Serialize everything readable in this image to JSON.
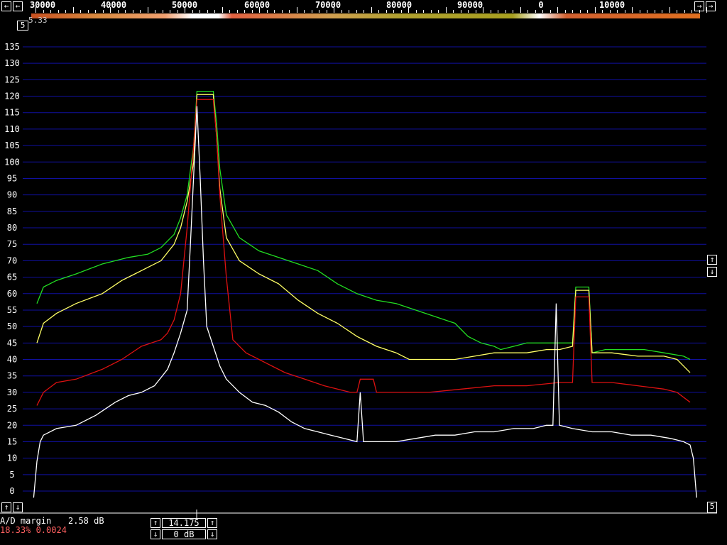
{
  "header": {
    "freq_labels": [
      "30000",
      "40000",
      "50000",
      "60000",
      "70000",
      "80000",
      "90000",
      "0",
      "10000"
    ],
    "left_scroll_icon": "left-arrow-icon",
    "right_scroll_icon": "right-arrow-icon"
  },
  "top_left": {
    "readout": "5.33",
    "box": "5"
  },
  "right_controls": {
    "up": "↑",
    "down": "↓"
  },
  "bottom_left_controls": {
    "up": "↑",
    "down": "↓"
  },
  "bottom_right_box": "5",
  "status": {
    "ad_margin_label": "A/D margin",
    "ad_margin_value": "2.58 dB",
    "cpu_line": "18.33% 0.0024"
  },
  "center_controls": {
    "top_value": "14.175",
    "bottom_value": "0 dB"
  },
  "colors": {
    "grid": "#1010a0",
    "green": "#22dd22",
    "yellow": "#ffff66",
    "red": "#dd1111",
    "white": "#ffffff"
  },
  "chart_data": {
    "type": "line",
    "title": "",
    "xlabel": "",
    "ylabel": "",
    "ylim": [
      -7,
      137
    ],
    "y_ticks": [
      0,
      5,
      10,
      15,
      20,
      25,
      30,
      35,
      40,
      45,
      50,
      55,
      60,
      65,
      70,
      75,
      80,
      85,
      90,
      95,
      100,
      105,
      110,
      115,
      120,
      125,
      130,
      135
    ],
    "x_tick_labels": [
      "30000",
      "40000",
      "50000",
      "60000",
      "70000",
      "80000",
      "90000",
      "0",
      "10000"
    ],
    "x_axis_note": "bin index 0..100 across the spectrum display",
    "series": [
      {
        "color": "#22dd22",
        "points": [
          [
            0,
            57
          ],
          [
            1,
            62
          ],
          [
            3,
            64
          ],
          [
            6,
            66
          ],
          [
            10,
            69
          ],
          [
            14,
            71
          ],
          [
            17,
            72
          ],
          [
            19,
            74
          ],
          [
            21,
            78
          ],
          [
            22,
            83
          ],
          [
            23,
            90
          ],
          [
            24,
            105
          ],
          [
            24.5,
            121.5
          ],
          [
            27,
            121.5
          ],
          [
            27.5,
            112
          ],
          [
            28,
            98
          ],
          [
            29,
            84
          ],
          [
            31,
            77
          ],
          [
            34,
            73
          ],
          [
            37,
            71
          ],
          [
            40,
            69
          ],
          [
            43,
            67
          ],
          [
            46,
            63
          ],
          [
            49,
            60
          ],
          [
            52,
            58
          ],
          [
            55,
            57
          ],
          [
            58,
            55
          ],
          [
            61,
            53
          ],
          [
            64,
            51
          ],
          [
            66,
            47
          ],
          [
            68,
            45
          ],
          [
            70,
            44
          ],
          [
            71,
            43
          ],
          [
            73,
            44
          ],
          [
            75,
            45
          ],
          [
            77,
            45
          ],
          [
            79,
            45
          ],
          [
            81,
            45
          ],
          [
            82,
            45
          ],
          [
            82.5,
            62
          ],
          [
            84.5,
            62
          ],
          [
            85,
            42
          ],
          [
            87,
            43
          ],
          [
            90,
            43
          ],
          [
            93,
            43
          ],
          [
            96,
            42
          ],
          [
            99,
            41
          ],
          [
            100,
            40
          ]
        ]
      },
      {
        "color": "#ffff66",
        "points": [
          [
            0,
            45
          ],
          [
            1,
            51
          ],
          [
            3,
            54
          ],
          [
            6,
            57
          ],
          [
            10,
            60
          ],
          [
            13,
            64
          ],
          [
            15,
            66
          ],
          [
            17,
            68
          ],
          [
            19,
            70
          ],
          [
            21,
            75
          ],
          [
            22,
            80
          ],
          [
            23,
            88
          ],
          [
            24,
            100
          ],
          [
            24.5,
            120.5
          ],
          [
            27,
            120.5
          ],
          [
            27.5,
            108
          ],
          [
            28,
            92
          ],
          [
            29,
            77
          ],
          [
            31,
            70
          ],
          [
            34,
            66
          ],
          [
            37,
            63
          ],
          [
            40,
            58
          ],
          [
            43,
            54
          ],
          [
            46,
            51
          ],
          [
            49,
            47
          ],
          [
            52,
            44
          ],
          [
            55,
            42
          ],
          [
            57,
            40
          ],
          [
            60,
            40
          ],
          [
            64,
            40
          ],
          [
            67,
            41
          ],
          [
            70,
            42
          ],
          [
            75,
            42
          ],
          [
            78,
            43
          ],
          [
            80,
            43
          ],
          [
            82,
            44
          ],
          [
            82.5,
            61
          ],
          [
            84.5,
            61
          ],
          [
            85,
            42
          ],
          [
            88,
            42
          ],
          [
            92,
            41
          ],
          [
            96,
            41
          ],
          [
            98,
            40
          ],
          [
            100,
            36
          ]
        ]
      },
      {
        "color": "#dd1111",
        "points": [
          [
            0,
            26
          ],
          [
            1,
            30
          ],
          [
            3,
            33
          ],
          [
            6,
            34
          ],
          [
            10,
            37
          ],
          [
            13,
            40
          ],
          [
            16,
            44
          ],
          [
            19,
            46
          ],
          [
            20,
            48
          ],
          [
            21,
            52
          ],
          [
            22,
            60
          ],
          [
            23,
            80
          ],
          [
            24,
            105
          ],
          [
            24.5,
            119
          ],
          [
            27,
            119
          ],
          [
            27.5,
            108
          ],
          [
            28,
            90
          ],
          [
            29,
            65
          ],
          [
            30,
            46
          ],
          [
            32,
            42
          ],
          [
            35,
            39
          ],
          [
            38,
            36
          ],
          [
            41,
            34
          ],
          [
            44,
            32
          ],
          [
            46,
            31
          ],
          [
            48,
            30
          ],
          [
            49,
            30
          ],
          [
            49.5,
            34
          ],
          [
            51.5,
            34
          ],
          [
            52,
            30
          ],
          [
            55,
            30
          ],
          [
            60,
            30
          ],
          [
            65,
            31
          ],
          [
            70,
            32
          ],
          [
            75,
            32
          ],
          [
            80,
            33
          ],
          [
            82,
            33
          ],
          [
            82.5,
            59
          ],
          [
            84.5,
            59
          ],
          [
            85,
            33
          ],
          [
            88,
            33
          ],
          [
            92,
            32
          ],
          [
            96,
            31
          ],
          [
            98,
            30
          ],
          [
            100,
            27
          ]
        ]
      },
      {
        "color": "#ffffff",
        "points": [
          [
            -0.5,
            -2
          ],
          [
            0,
            9
          ],
          [
            0.5,
            15
          ],
          [
            1,
            17
          ],
          [
            3,
            19
          ],
          [
            6,
            20
          ],
          [
            9,
            23
          ],
          [
            12,
            27
          ],
          [
            14,
            29
          ],
          [
            16,
            30
          ],
          [
            18,
            32
          ],
          [
            20,
            37
          ],
          [
            21,
            42
          ],
          [
            22,
            48
          ],
          [
            23,
            55
          ],
          [
            23.5,
            75
          ],
          [
            24,
            96
          ],
          [
            24.5,
            117
          ],
          [
            25,
            95
          ],
          [
            25.5,
            70
          ],
          [
            26,
            50
          ],
          [
            27,
            44
          ],
          [
            28,
            38
          ],
          [
            29,
            34
          ],
          [
            31,
            30
          ],
          [
            33,
            27
          ],
          [
            35,
            26
          ],
          [
            37,
            24
          ],
          [
            39,
            21
          ],
          [
            41,
            19
          ],
          [
            43,
            18
          ],
          [
            45,
            17
          ],
          [
            47,
            16
          ],
          [
            49,
            15
          ],
          [
            49.5,
            30
          ],
          [
            50,
            15
          ],
          [
            52,
            15
          ],
          [
            55,
            15
          ],
          [
            58,
            16
          ],
          [
            61,
            17
          ],
          [
            64,
            17
          ],
          [
            67,
            18
          ],
          [
            70,
            18
          ],
          [
            73,
            19
          ],
          [
            76,
            19
          ],
          [
            78,
            20
          ],
          [
            79,
            20
          ],
          [
            79.5,
            57
          ],
          [
            80,
            20
          ],
          [
            82,
            19
          ],
          [
            85,
            18
          ],
          [
            88,
            18
          ],
          [
            91,
            17
          ],
          [
            94,
            17
          ],
          [
            97,
            16
          ],
          [
            99,
            15
          ],
          [
            100,
            14
          ],
          [
            100.5,
            10
          ],
          [
            101,
            -2
          ]
        ]
      }
    ]
  }
}
